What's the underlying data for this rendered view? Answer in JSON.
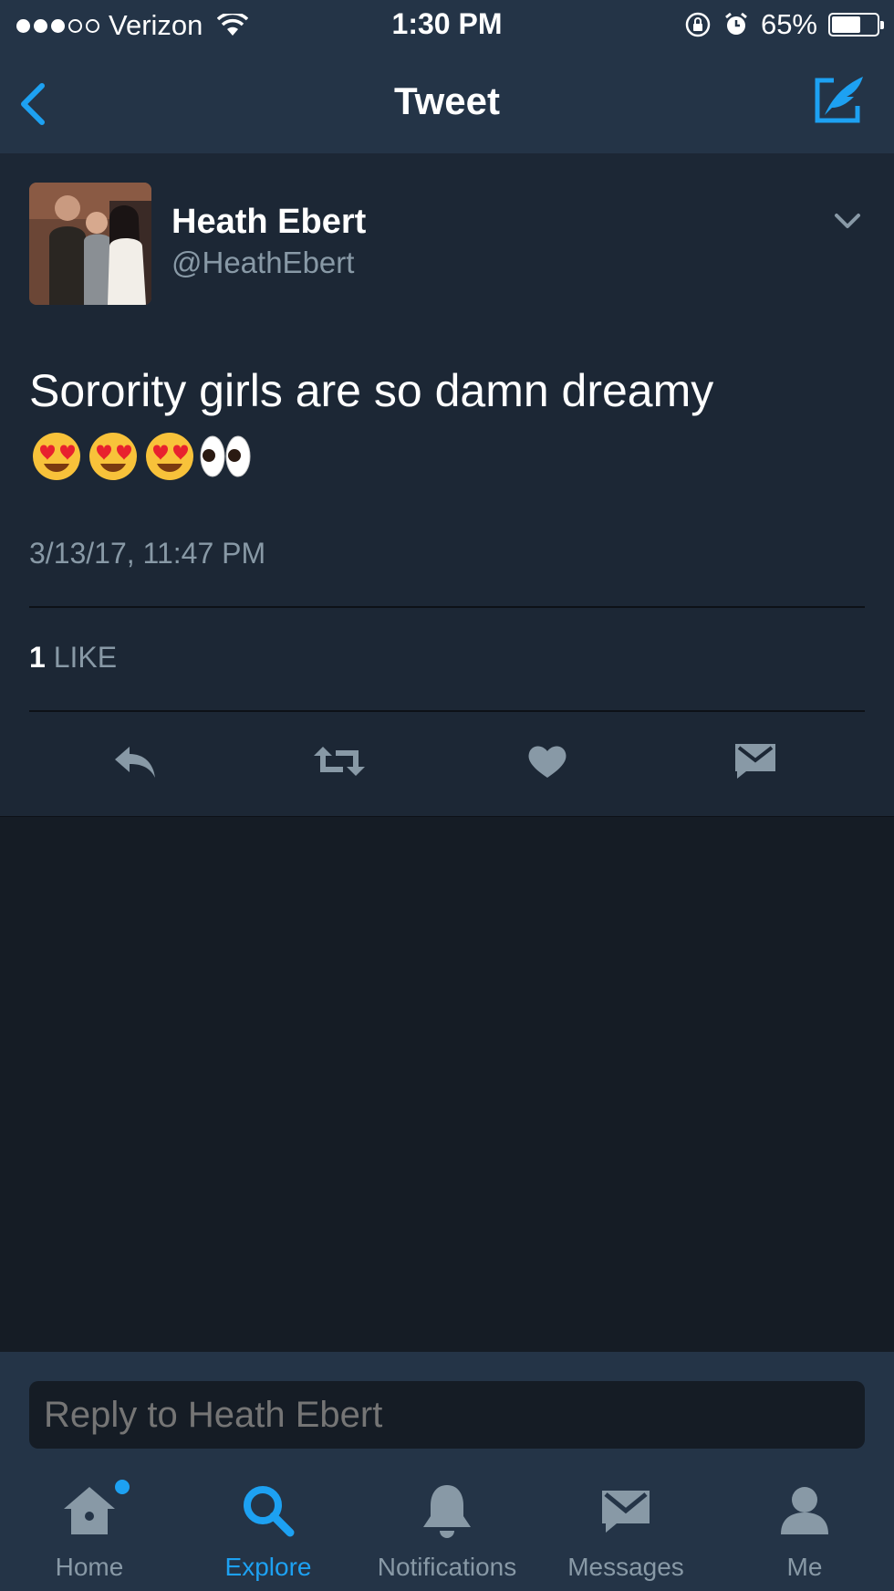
{
  "status_bar": {
    "carrier": "Verizon",
    "time": "1:30 PM",
    "battery_percent": "65%",
    "battery_level": 0.65,
    "signal_bars_filled": 3,
    "signal_bars_total": 5
  },
  "nav": {
    "title": "Tweet",
    "back_icon": "chevron-left-icon",
    "compose_icon": "compose-tweet-icon"
  },
  "tweet": {
    "author_name": "Heath Ebert",
    "author_handle": "@HeathEbert",
    "text": "Sorority girls are so damn dreamy",
    "emojis": [
      "heart-eyes-emoji",
      "heart-eyes-emoji",
      "heart-eyes-emoji",
      "eyes-emoji"
    ],
    "timestamp": "3/13/17, 11:47 PM",
    "likes_count": "1",
    "likes_label": "LIKE",
    "actions": [
      "reply-icon",
      "retweet-icon",
      "like-icon",
      "direct-message-icon"
    ]
  },
  "reply": {
    "placeholder": "Reply to Heath Ebert"
  },
  "tabs": [
    {
      "label": "Home",
      "icon": "home-icon",
      "active": false,
      "has_notification_dot": true
    },
    {
      "label": "Explore",
      "icon": "search-icon",
      "active": true
    },
    {
      "label": "Notifications",
      "icon": "bell-icon",
      "active": false
    },
    {
      "label": "Messages",
      "icon": "envelope-icon",
      "active": false
    },
    {
      "label": "Me",
      "icon": "profile-icon",
      "active": false
    }
  ],
  "colors": {
    "accent": "#1da1f2",
    "header_bg": "#243447",
    "card_bg": "#1c2735",
    "page_bg": "#151c25",
    "muted_text": "#8899a6"
  }
}
